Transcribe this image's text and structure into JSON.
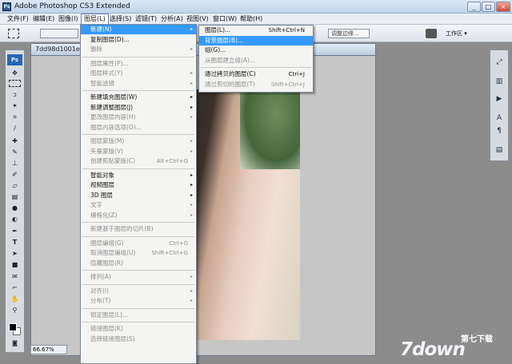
{
  "app": {
    "title": "Adobe Photoshop CS3 Extended",
    "logo": "Ps",
    "controls": [
      "_",
      "□",
      "×"
    ]
  },
  "menubar": [
    "文件(F)",
    "编辑(E)",
    "图像(I)",
    "图层(L)",
    "选择(S)",
    "滤镜(T)",
    "分析(A)",
    "视图(V)",
    "窗口(W)",
    "帮助(H)"
  ],
  "options": {
    "refine_edge": "调整边缘...",
    "workspace": "工作区 ▾"
  },
  "document": {
    "title": "7dd98d1001e",
    "zoom": "66.67%"
  },
  "layer_menu": [
    {
      "label": "新建(N)",
      "arrow": "▸",
      "state": "hl"
    },
    {
      "label": "复制图层(D)..."
    },
    {
      "label": "删除",
      "arrow": "▸",
      "state": "dis"
    },
    {
      "sep": true
    },
    {
      "label": "图层属性(P)...",
      "state": "dis"
    },
    {
      "label": "图层样式(Y)",
      "arrow": "▸",
      "state": "dis"
    },
    {
      "label": "智能滤镜",
      "arrow": "▸",
      "state": "dis"
    },
    {
      "sep": true
    },
    {
      "label": "新建填充图层(W)",
      "arrow": "▸"
    },
    {
      "label": "新建调整图层(J)",
      "arrow": "▸"
    },
    {
      "label": "更改图层内容(H)",
      "arrow": "▸",
      "state": "dis"
    },
    {
      "label": "图层内容选项(O)...",
      "state": "dis"
    },
    {
      "sep": true
    },
    {
      "label": "图层蒙版(M)",
      "arrow": "▸",
      "state": "dis"
    },
    {
      "label": "矢量蒙版(V)",
      "arrow": "▸",
      "state": "dis"
    },
    {
      "label": "创建剪贴蒙版(C)",
      "shortcut": "Alt+Ctrl+G",
      "state": "dis"
    },
    {
      "sep": true
    },
    {
      "label": "智能对象",
      "arrow": "▸"
    },
    {
      "label": "视频图层",
      "arrow": "▸"
    },
    {
      "label": "3D 图层",
      "arrow": "▸"
    },
    {
      "label": "文字",
      "arrow": "▸",
      "state": "dis"
    },
    {
      "label": "栅格化(Z)",
      "arrow": "▸",
      "state": "dis"
    },
    {
      "sep": true
    },
    {
      "label": "新建基于图层的切片(B)",
      "state": "dis"
    },
    {
      "sep": true
    },
    {
      "label": "图层编组(G)",
      "shortcut": "Ctrl+G",
      "state": "dis"
    },
    {
      "label": "取消图层编组(U)",
      "shortcut": "Shift+Ctrl+G",
      "state": "dis"
    },
    {
      "label": "隐藏图层(R)",
      "state": "dis"
    },
    {
      "sep": true
    },
    {
      "label": "排列(A)",
      "arrow": "▸",
      "state": "dis"
    },
    {
      "sep": true
    },
    {
      "label": "对齐(I)",
      "arrow": "▸",
      "state": "dis"
    },
    {
      "label": "分布(T)",
      "arrow": "▸",
      "state": "dis"
    },
    {
      "sep": true
    },
    {
      "label": "锁定图层(L)...",
      "state": "dis"
    },
    {
      "sep": true
    },
    {
      "label": "链接图层(K)",
      "state": "dis"
    },
    {
      "label": "选择链接图层(S)",
      "state": "dis"
    }
  ],
  "new_submenu": [
    {
      "label": "图层(L)...",
      "shortcut": "Shift+Ctrl+N"
    },
    {
      "label": "背景图层(B)...",
      "state": "hl"
    },
    {
      "label": "组(G)..."
    },
    {
      "label": "从图层建立组(A)...",
      "state": "dis"
    },
    {
      "sep": true
    },
    {
      "label": "通过拷贝的图层(C)",
      "shortcut": "Ctrl+J"
    },
    {
      "label": "通过剪切的图层(T)",
      "shortcut": "Shift+Ctrl+J",
      "state": "dis"
    }
  ],
  "watermark": {
    "main": "7down",
    "sub": "第七下载"
  }
}
